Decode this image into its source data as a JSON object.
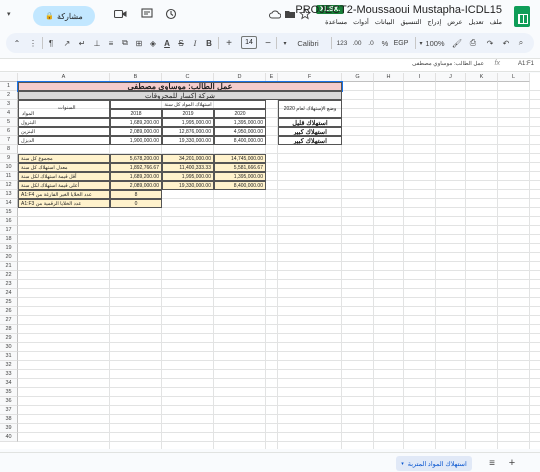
{
  "title": {
    "doc_title": "PROJECT2-Moussaoui Mustapha-ICDL15",
    "badge": "XLSX."
  },
  "share": {
    "label": "مشاركة"
  },
  "menu": [
    "ملف",
    "تعديل",
    "عرض",
    "إدراج",
    "التنسيق",
    "البيانات",
    "أدوات",
    "مساعدة"
  ],
  "toolbar": {
    "zoom": "100%",
    "currency": "EGP",
    "percent": "%",
    "decimals": "123",
    "font": "Calibri",
    "font_size": "14"
  },
  "formula": {
    "cell_ref": "A1:F1",
    "value": "عمل الطالب: موساوي مصطفى",
    "fx": "fx"
  },
  "columns": [
    "A",
    "B",
    "C",
    "D",
    "E",
    "F",
    "G",
    "H",
    "I",
    "J",
    "K",
    "L"
  ],
  "rows": [
    "1",
    "2",
    "3",
    "4",
    "5",
    "6",
    "7",
    "8",
    "9",
    "10",
    "11",
    "12",
    "13",
    "14",
    "15",
    "16",
    "17",
    "18",
    "19",
    "20",
    "21",
    "22",
    "23",
    "24",
    "25",
    "26",
    "27",
    "28",
    "29",
    "30",
    "31",
    "32",
    "33",
    "34",
    "35",
    "36",
    "37",
    "38",
    "39",
    "40"
  ],
  "sheet": {
    "title_cell": "عمل الطالب: موساوي مصطفى",
    "company": "شركة إكسار للمحروقات",
    "consumption_header": "استهلاك المواد كل سنة",
    "status_header": "وضع الإستهلاك لعام 2020",
    "year_header": "السنوات",
    "product_header": "المواد",
    "years": [
      "2018",
      "2019",
      "2020"
    ],
    "products": [
      {
        "name": "البترول",
        "v2018": "1,689,200.00",
        "v2019": "1,995,000.00",
        "v2020": "1,395,000.00",
        "status": "استهلاك قليل"
      },
      {
        "name": "البنزين",
        "v2018": "2,089,000.00",
        "v2019": "12,876,000.00",
        "v2020": "4,950,000.00",
        "status": "استهلاك كبير"
      },
      {
        "name": "الديزل",
        "v2018": "1,900,000.00",
        "v2019": "19,330,000.00",
        "v2020": "8,400,000.00",
        "status": "استهلاك كبير"
      }
    ],
    "summary": [
      {
        "label": "مجموع كل سنة",
        "v2018": "5,678,200.00",
        "v2019": "34,201,000.00",
        "v2020": "14,745,000.00"
      },
      {
        "label": "معدل استهلاك كل سنة",
        "v2018": "1,892,766.67",
        "v2019": "11,400,333.33",
        "v2020": "5,581,666.67"
      },
      {
        "label": "أقل قيمة استهلاك لكل سنة",
        "v2018": "1,689,200.00",
        "v2019": "1,995,000.00",
        "v2020": "1,395,000.00"
      },
      {
        "label": "أعلى قيمة استهلاك لكل سنة",
        "v2018": "2,089,000.00",
        "v2019": "19,330,000.00",
        "v2020": "8,400,000.00"
      }
    ],
    "counts": [
      {
        "label": "عدد الخلايا الغير الفارغة من A1:F4",
        "value": "8"
      },
      {
        "label": "عدد الخلايا الرقمية من A1:F3",
        "value": "0"
      }
    ]
  },
  "bottom": {
    "sheet_tab": "استهلاك المواد المتربة",
    "add_sheet": "+",
    "all_sheets": "≡"
  },
  "colors": {
    "title_fill": "#f4cccc",
    "company_fill": "#d9d9d9",
    "data_fill": "#fff2cc",
    "selection": "#1a73e8"
  }
}
